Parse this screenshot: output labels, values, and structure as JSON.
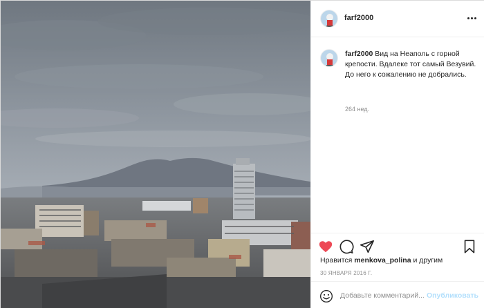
{
  "post": {
    "author": "farf2000",
    "more_icon": "more-horizontal-icon",
    "photo_alt": "",
    "caption": {
      "username": "farf2000",
      "text": "Вид на Неаполь с горной крепости. Вдалеке тот самый Везувий. До него к сожалению не добрались.",
      "time_ago": "264 нед."
    },
    "actions": {
      "like_icon": "heart-filled-icon",
      "comment_icon": "comment-icon",
      "share_icon": "share-icon",
      "save_icon": "bookmark-icon",
      "like_color": "#ed4956"
    },
    "likes": {
      "prefix": "Нравится",
      "user": "menkova_polina",
      "suffix": "и другим"
    },
    "date": "30 ЯНВАРЯ 2016 Г.",
    "add_comment": {
      "emoji_icon": "smiley-icon",
      "placeholder": "Добавьте комментарий...",
      "publish_label": "Опубликовать",
      "publish_color": "#b2dffc"
    }
  }
}
